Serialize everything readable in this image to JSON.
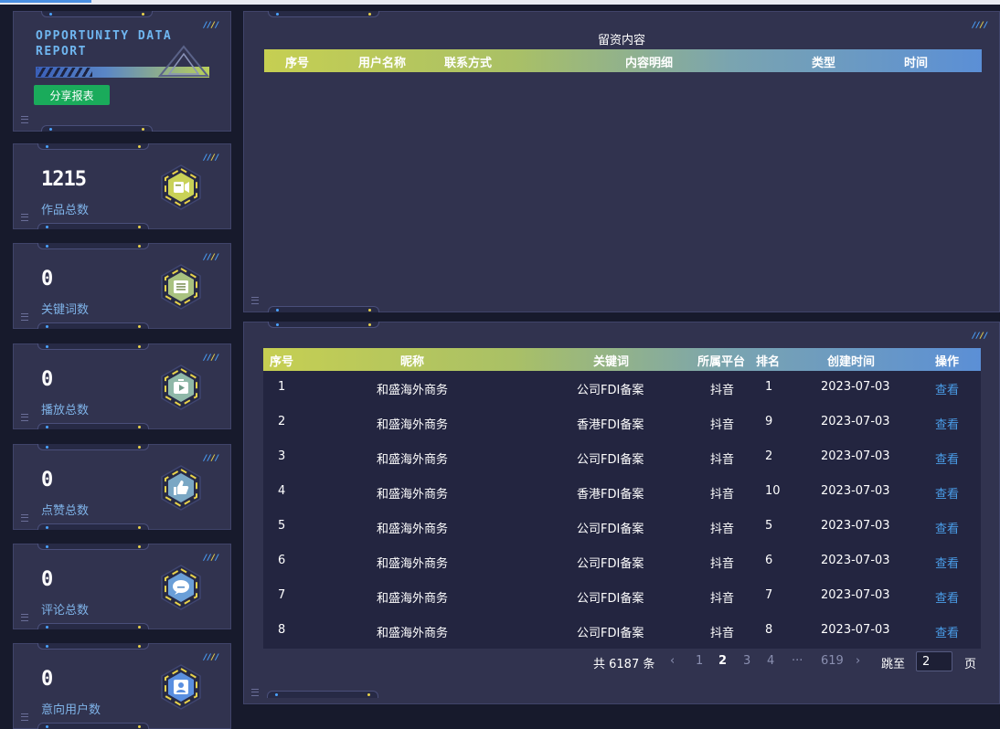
{
  "brand": {
    "logo_line1": "OPPORTUNITY DATA",
    "logo_line2": "REPORT",
    "share_label": "分享报表"
  },
  "stats": [
    {
      "value": "1215",
      "label": "作品总数",
      "icon": "video-camera-icon",
      "hex_color": "#c9d257"
    },
    {
      "value": "0",
      "label": "关键词数",
      "icon": "list-icon",
      "hex_color": "#a9c280"
    },
    {
      "value": "0",
      "label": "播放总数",
      "icon": "play-icon",
      "hex_color": "#8fb8a8"
    },
    {
      "value": "0",
      "label": "点赞总数",
      "icon": "thumbs-up-icon",
      "hex_color": "#7aa7c4"
    },
    {
      "value": "0",
      "label": "评论总数",
      "icon": "comment-icon",
      "hex_color": "#6a9fd8"
    },
    {
      "value": "0",
      "label": "意向用户数",
      "icon": "user-icon",
      "hex_color": "#5a8fe0"
    }
  ],
  "leads": {
    "title": "留资内容",
    "columns": [
      "序号",
      "用户名称",
      "联系方式",
      "内容明细",
      "类型",
      "时间"
    ]
  },
  "ranking": {
    "columns": [
      "序号",
      "昵称",
      "关键词",
      "所属平台",
      "排名",
      "创建时间",
      "操作"
    ],
    "rows": [
      {
        "no": "1",
        "name": "和盛海外商务",
        "keyword": "公司FDI备案",
        "platform": "抖音",
        "rank": "1",
        "created": "2023-07-03",
        "action": "查看"
      },
      {
        "no": "2",
        "name": "和盛海外商务",
        "keyword": "香港FDI备案",
        "platform": "抖音",
        "rank": "9",
        "created": "2023-07-03",
        "action": "查看"
      },
      {
        "no": "3",
        "name": "和盛海外商务",
        "keyword": "公司FDI备案",
        "platform": "抖音",
        "rank": "2",
        "created": "2023-07-03",
        "action": "查看"
      },
      {
        "no": "4",
        "name": "和盛海外商务",
        "keyword": "香港FDI备案",
        "platform": "抖音",
        "rank": "10",
        "created": "2023-07-03",
        "action": "查看"
      },
      {
        "no": "5",
        "name": "和盛海外商务",
        "keyword": "公司FDI备案",
        "platform": "抖音",
        "rank": "5",
        "created": "2023-07-03",
        "action": "查看"
      },
      {
        "no": "6",
        "name": "和盛海外商务",
        "keyword": "公司FDI备案",
        "platform": "抖音",
        "rank": "6",
        "created": "2023-07-03",
        "action": "查看"
      },
      {
        "no": "7",
        "name": "和盛海外商务",
        "keyword": "公司FDI备案",
        "platform": "抖音",
        "rank": "7",
        "created": "2023-07-03",
        "action": "查看"
      },
      {
        "no": "8",
        "name": "和盛海外商务",
        "keyword": "公司FDI备案",
        "platform": "抖音",
        "rank": "8",
        "created": "2023-07-03",
        "action": "查看"
      }
    ]
  },
  "pagination": {
    "total_text": "共 6187 条",
    "prev": "‹",
    "pages": [
      "1",
      "2",
      "3",
      "4"
    ],
    "current": "2",
    "ellipsis": "···",
    "last": "619",
    "next": "›",
    "jump_label": "跳至",
    "jump_value": "2",
    "page_suffix": "页"
  },
  "colors": {
    "panel_bg": "#31334f",
    "page_bg": "#171a2c",
    "share_button": "#1aab5b",
    "link": "#4a9de8",
    "label": "#7fb3e8"
  }
}
